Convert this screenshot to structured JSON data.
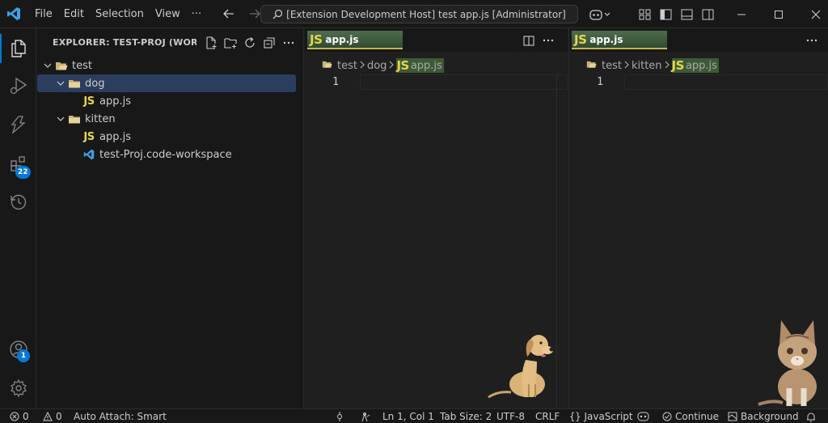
{
  "titlebar": {
    "menu": [
      "File",
      "Edit",
      "Selection",
      "View",
      "···"
    ],
    "command_center": "[Extension Development Host] test app.js [Administrator]"
  },
  "activitybar": {
    "extensions_badge": "22",
    "accounts_badge": "1"
  },
  "explorer": {
    "title": "EXPLORER: TEST-PROJ (WORKS...",
    "tree": [
      {
        "label": "test",
        "type": "root-folder",
        "depth": 0
      },
      {
        "label": "dog",
        "type": "folder",
        "depth": 1
      },
      {
        "label": "app.js",
        "type": "js",
        "depth": 2
      },
      {
        "label": "kitten",
        "type": "folder",
        "depth": 1
      },
      {
        "label": "app.js",
        "type": "js",
        "depth": 2
      },
      {
        "label": "test-Proj.code-workspace",
        "type": "workspace",
        "depth": 1
      }
    ]
  },
  "editors": [
    {
      "tab_label": "app.js",
      "breadcrumb": [
        "test",
        "dog",
        "app.js"
      ],
      "line_number": "1"
    },
    {
      "tab_label": "app.js",
      "breadcrumb": [
        "test",
        "kitten",
        "app.js"
      ],
      "line_number": "1"
    }
  ],
  "icon_text": {
    "js": "JS"
  },
  "statusbar": {
    "errors": "0",
    "warnings": "0",
    "auto_attach": "Auto Attach: Smart",
    "position": "Ln 1, Col 1",
    "tab_size": "Tab Size: 2",
    "encoding": "UTF-8",
    "eol": "CRLF",
    "language": "JavaScript",
    "continue": "Continue",
    "background": "Background"
  },
  "colors": {
    "accent": "#0078d4",
    "js_yellow": "#e8d44d",
    "selection": "#2c3e5d",
    "tab_green": "#3d5a3d"
  }
}
